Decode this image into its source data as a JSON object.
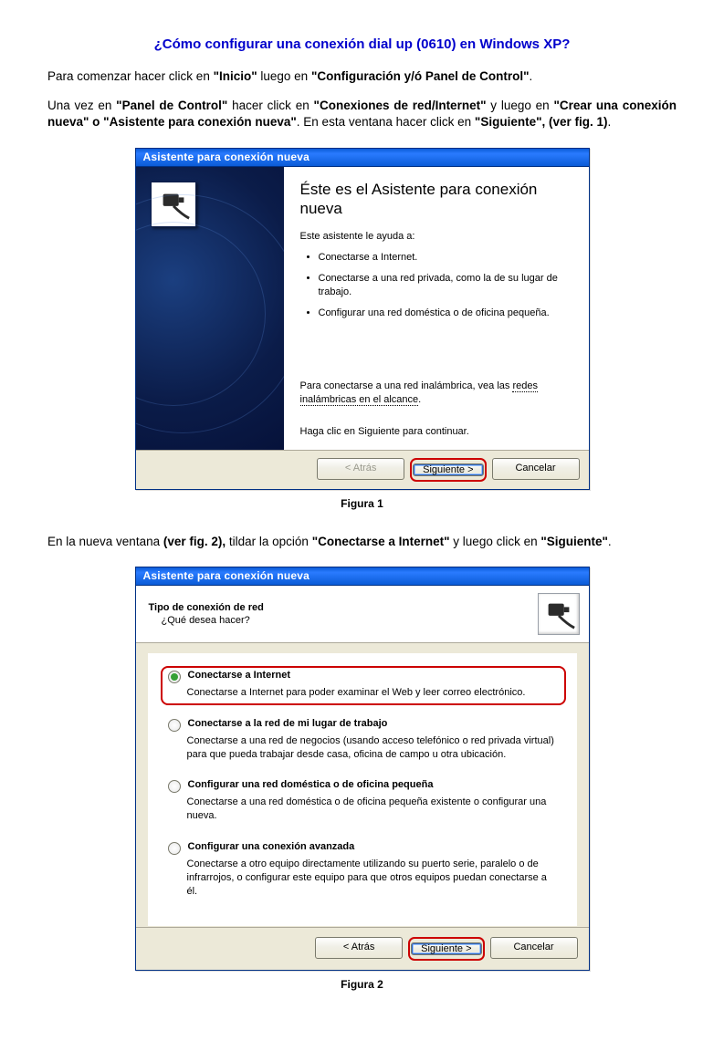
{
  "doc": {
    "title": "¿Cómo configurar una conexión dial up (0610) en Windows XP?",
    "para1_a": "Para comenzar hacer click en ",
    "para1_b": "\"Inicio\"",
    "para1_c": " luego en ",
    "para1_d": "\"Configuración y/ó Panel de Control\"",
    "para1_e": ".",
    "para2_a": "Una vez en ",
    "para2_b": "\"Panel de Control\"",
    "para2_c": " hacer click en ",
    "para2_d": "\"Conexiones de red/Internet\"",
    "para2_e": " y luego en ",
    "para2_f": "\"Crear una conexión nueva\" o \"Asistente para conexión nueva\"",
    "para2_g": ". En esta ventana hacer click en ",
    "para2_h": "\"Siguiente\", (ver fig. 1)",
    "para2_i": ".",
    "para3_a": "En la nueva ventana ",
    "para3_b": "(ver fig. 2),",
    "para3_c": " tildar la opción ",
    "para3_d": "\"Conectarse a Internet\"",
    "para3_e": " y luego click en ",
    "para3_f": "\"Siguiente\"",
    "para3_g": "."
  },
  "fig1": {
    "titlebar": "Asistente para conexión nueva",
    "heading": "Éste es el Asistente para conexión nueva",
    "lead": "Este asistente le ayuda a:",
    "bullet1": "Conectarse a Internet.",
    "bullet2": "Conectarse a una red privada, como la de su lugar de trabajo.",
    "bullet3": "Configurar una red doméstica o de oficina pequeña.",
    "wireless_a": "Para conectarse a una red inalámbrica, vea las ",
    "wireless_link": "redes inalámbricas en el alcance",
    "wireless_b": ".",
    "continue": "Haga clic en Siguiente para continuar.",
    "btn_back": "< Atrás",
    "btn_next": "Siguiente >",
    "btn_cancel": "Cancelar",
    "caption": "Figura 1"
  },
  "fig2": {
    "titlebar": "Asistente para conexión nueva",
    "header_title": "Tipo de conexión de red",
    "header_sub": "¿Qué desea hacer?",
    "opt1_title": "Conectarse a Internet",
    "opt1_desc": "Conectarse a Internet para poder examinar el Web y leer correo electrónico.",
    "opt2_title": "Conectarse a la red de mi lugar de trabajo",
    "opt2_desc": "Conectarse a una red de negocios (usando acceso telefónico o red privada virtual) para que pueda trabajar desde casa, oficina de campo u otra ubicación.",
    "opt3_title": "Configurar una red doméstica o de oficina pequeña",
    "opt3_desc": "Conectarse a una red doméstica o de oficina pequeña existente o configurar una nueva.",
    "opt4_title": "Configurar una conexión avanzada",
    "opt4_desc": "Conectarse a otro equipo directamente utilizando su puerto serie, paralelo o de infrarrojos, o configurar este equipo para que otros equipos puedan conectarse a él.",
    "btn_back": "< Atrás",
    "btn_next": "Siguiente >",
    "btn_cancel": "Cancelar",
    "caption": "Figura 2"
  }
}
